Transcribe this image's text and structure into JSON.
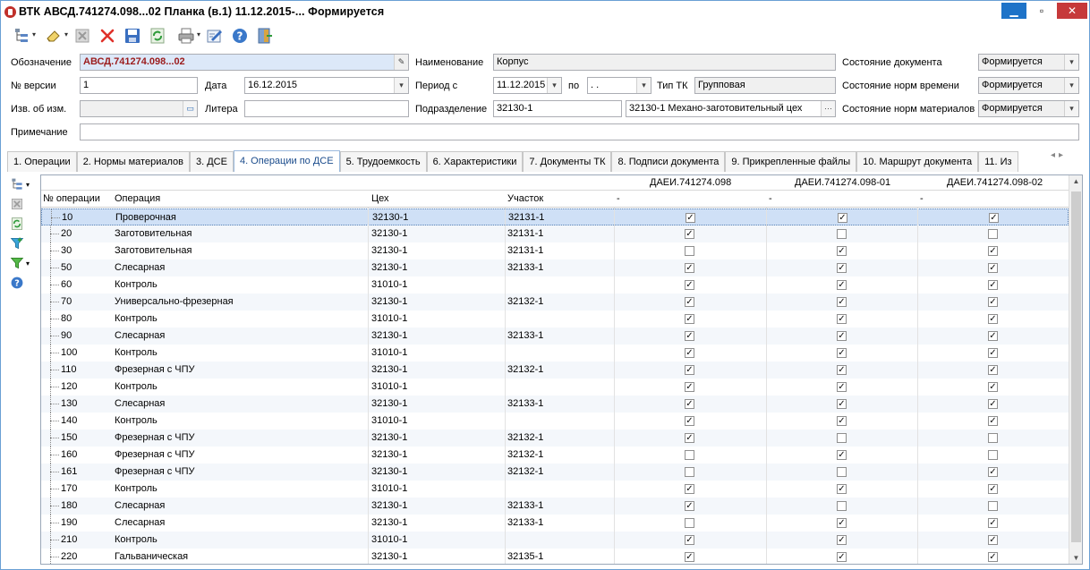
{
  "window": {
    "title": "ВТК АВСД.741274.098...02 Планка (в.1) 11.12.2015-... Формируется",
    "min_glyph": "▁",
    "max_glyph": "▫",
    "close_glyph": "✕"
  },
  "toolbar": {
    "icons": [
      "tree-tools-icon",
      "eraser-icon",
      "delete-gray-icon",
      "delete-red-icon",
      "save-icon",
      "refresh-icon",
      "print-icon",
      "edit-icon",
      "help-icon",
      "exit-icon"
    ]
  },
  "form": {
    "designation_label": "Обозначение",
    "designation_value": "АВСД.741274.098...02",
    "version_label": "№ версии",
    "version_value": "1",
    "date_label": "Дата",
    "date_value": "16.12.2015",
    "change_notice_label": "Изв. об изм.",
    "change_notice_value": "",
    "litera_label": "Литера",
    "litera_value": "",
    "note_label": "Примечание",
    "note_value": "",
    "name_label": "Наименование",
    "name_value": "Корпус",
    "period_label": "Период с",
    "period_from": "11.12.2015",
    "period_to_label": "по",
    "period_to": " .  .",
    "tk_type_label": "Тип ТК",
    "tk_type_value": "Групповая",
    "division_label": "Подразделение",
    "division_code": "32130-1",
    "division_name": "32130-1 Механо-заготовительный цех",
    "doc_state_label": "Состояние документа",
    "doc_state_value": "Формируется",
    "time_state_label": "Состояние норм времени",
    "time_state_value": "Формируется",
    "mat_state_label": "Состояние норм материалов",
    "mat_state_value": "Формируется"
  },
  "tabs": [
    {
      "label": "1. Операции",
      "active": false
    },
    {
      "label": "2. Нормы материалов",
      "active": false
    },
    {
      "label": "3. ДСЕ",
      "active": false
    },
    {
      "label": "4. Операции по ДСЕ",
      "active": true
    },
    {
      "label": "5. Трудоемкость",
      "active": false
    },
    {
      "label": "6. Характеристики",
      "active": false
    },
    {
      "label": "7. Документы ТК",
      "active": false
    },
    {
      "label": "8. Подписи документа",
      "active": false
    },
    {
      "label": "9. Прикрепленные файлы",
      "active": false
    },
    {
      "label": "10. Маршрут документа",
      "active": false
    },
    {
      "label": "11. Из",
      "active": false
    }
  ],
  "grid": {
    "group_headers": [
      "ДАЕИ.741274.098",
      "ДАЕИ.741274.098-01",
      "ДАЕИ.741274.098-02"
    ],
    "sub_headers": [
      "-",
      "-",
      "-"
    ],
    "columns": [
      "№ операции",
      "Операция",
      "Цех",
      "Участок"
    ],
    "rows": [
      {
        "num": "10",
        "op": "Проверочная",
        "shop": "32130-1",
        "area": "32131-1",
        "c": [
          true,
          true,
          true
        ]
      },
      {
        "num": "20",
        "op": "Заготовительная",
        "shop": "32130-1",
        "area": "32131-1",
        "c": [
          true,
          false,
          false
        ]
      },
      {
        "num": "30",
        "op": "Заготовительная",
        "shop": "32130-1",
        "area": "32131-1",
        "c": [
          false,
          true,
          true
        ]
      },
      {
        "num": "50",
        "op": "Слесарная",
        "shop": "32130-1",
        "area": "32133-1",
        "c": [
          true,
          true,
          true
        ]
      },
      {
        "num": "60",
        "op": "Контроль",
        "shop": "31010-1",
        "area": "",
        "c": [
          true,
          true,
          true
        ]
      },
      {
        "num": "70",
        "op": "Универсально-фрезерная",
        "shop": "32130-1",
        "area": "32132-1",
        "c": [
          true,
          true,
          true
        ]
      },
      {
        "num": "80",
        "op": "Контроль",
        "shop": "31010-1",
        "area": "",
        "c": [
          true,
          true,
          true
        ]
      },
      {
        "num": "90",
        "op": "Слесарная",
        "shop": "32130-1",
        "area": "32133-1",
        "c": [
          true,
          true,
          true
        ]
      },
      {
        "num": "100",
        "op": "Контроль",
        "shop": "31010-1",
        "area": "",
        "c": [
          true,
          true,
          true
        ]
      },
      {
        "num": "110",
        "op": "Фрезерная с ЧПУ",
        "shop": "32130-1",
        "area": "32132-1",
        "c": [
          true,
          true,
          true
        ]
      },
      {
        "num": "120",
        "op": "Контроль",
        "shop": "31010-1",
        "area": "",
        "c": [
          true,
          true,
          true
        ]
      },
      {
        "num": "130",
        "op": "Слесарная",
        "shop": "32130-1",
        "area": "32133-1",
        "c": [
          true,
          true,
          true
        ]
      },
      {
        "num": "140",
        "op": "Контроль",
        "shop": "31010-1",
        "area": "",
        "c": [
          true,
          true,
          true
        ]
      },
      {
        "num": "150",
        "op": "Фрезерная с ЧПУ",
        "shop": "32130-1",
        "area": "32132-1",
        "c": [
          true,
          false,
          false
        ]
      },
      {
        "num": "160",
        "op": "Фрезерная с ЧПУ",
        "shop": "32130-1",
        "area": "32132-1",
        "c": [
          false,
          true,
          false
        ]
      },
      {
        "num": "161",
        "op": "Фрезерная с ЧПУ",
        "shop": "32130-1",
        "area": "32132-1",
        "c": [
          false,
          false,
          true
        ]
      },
      {
        "num": "170",
        "op": "Контроль",
        "shop": "31010-1",
        "area": "",
        "c": [
          true,
          true,
          true
        ]
      },
      {
        "num": "180",
        "op": "Слесарная",
        "shop": "32130-1",
        "area": "32133-1",
        "c": [
          true,
          false,
          false
        ]
      },
      {
        "num": "190",
        "op": "Слесарная",
        "shop": "32130-1",
        "area": "32133-1",
        "c": [
          false,
          true,
          true
        ]
      },
      {
        "num": "210",
        "op": "Контроль",
        "shop": "31010-1",
        "area": "",
        "c": [
          true,
          true,
          true
        ]
      },
      {
        "num": "220",
        "op": "Гальваническая",
        "shop": "32130-1",
        "area": "32135-1",
        "c": [
          true,
          true,
          true
        ]
      }
    ]
  },
  "check_glyph": "✓",
  "colors": {
    "accent": "#1e73c8",
    "close": "#c6393a",
    "designation_text": "#9b1c1c",
    "selection": "#cfe0f6"
  }
}
